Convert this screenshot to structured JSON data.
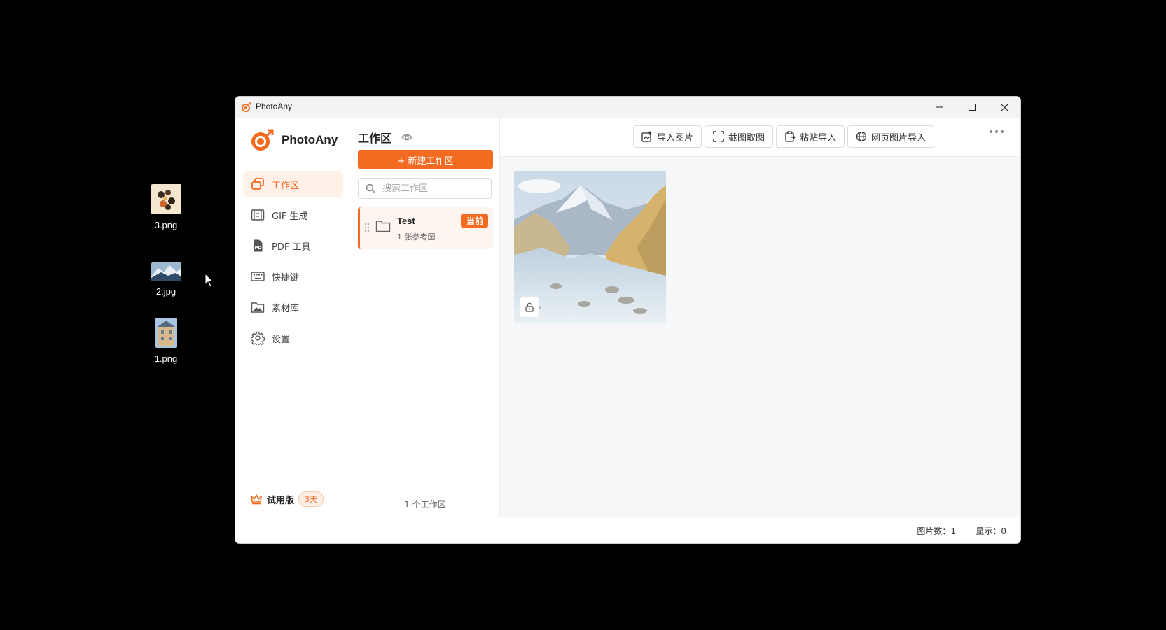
{
  "desktop": {
    "icons": [
      {
        "label": "3.png"
      },
      {
        "label": "2.jpg"
      },
      {
        "label": "1.png"
      }
    ]
  },
  "window": {
    "title": "PhotoAny"
  },
  "sidebar": {
    "brand": "PhotoAny",
    "items": [
      {
        "label": "工作区",
        "icon": "workspace-icon",
        "active": true
      },
      {
        "label": "GIF 生成",
        "icon": "gif-icon"
      },
      {
        "label": "PDF 工具",
        "icon": "pdf-icon"
      },
      {
        "label": "快捷键",
        "icon": "keyboard-icon"
      },
      {
        "label": "素材库",
        "icon": "image-library-icon"
      },
      {
        "label": "设置",
        "icon": "gear-icon"
      }
    ],
    "trial": {
      "label": "试用版",
      "days": "3天"
    }
  },
  "workspace_panel": {
    "title": "工作区",
    "new_button": "+ 新建工作区",
    "search_placeholder": "搜索工作区",
    "workspaces": [
      {
        "name": "Test",
        "subtitle": "1 张参考图",
        "badge": "当前"
      }
    ],
    "footer": "1 个工作区"
  },
  "toolbar": {
    "import_image": "导入图片",
    "screenshot": "截图取图",
    "paste_import": "粘贴导入",
    "web_import": "网页图片导入"
  },
  "statusbar": {
    "image_count": "图片数：1",
    "display": "显示：0"
  },
  "colors": {
    "accent": "#f26b21",
    "accent_light": "#fff1e8"
  }
}
